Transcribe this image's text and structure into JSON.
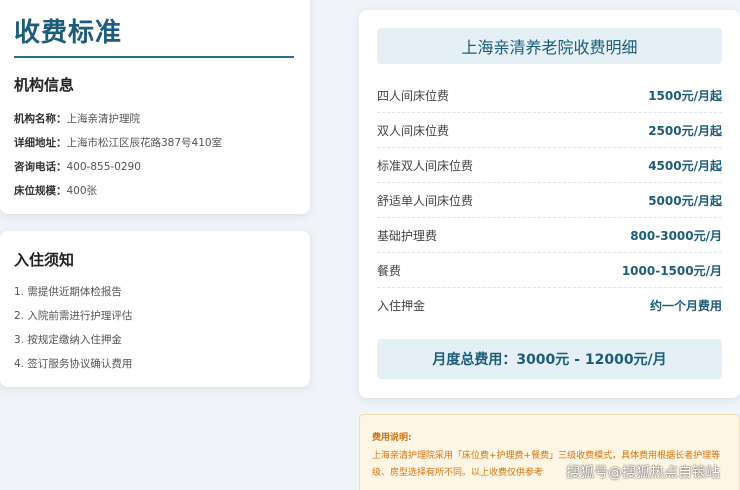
{
  "page": {
    "title": "收费标准"
  },
  "institution": {
    "heading": "机构信息",
    "fields": [
      {
        "label": "机构名称：",
        "value": "上海亲清护理院"
      },
      {
        "label": "详细地址：",
        "value": "上海市松江区辰花路387号410室"
      },
      {
        "label": "咨询电话：",
        "value": "400-855-0290"
      },
      {
        "label": "床位规模：",
        "value": "400张"
      }
    ]
  },
  "notice": {
    "heading": "入住须知",
    "items": [
      "1. 需提供近期体检报告",
      "2. 入院前需进行护理评估",
      "3. 按规定缴纳入住押金",
      "4. 签订服务协议确认费用"
    ]
  },
  "fees": {
    "heading": "上海亲清养老院收费明细",
    "rows": [
      {
        "name": "四人间床位费",
        "value": "1500元/月起"
      },
      {
        "name": "双人间床位费",
        "value": "2500元/月起"
      },
      {
        "name": "标准双人间床位费",
        "value": "4500元/月起"
      },
      {
        "name": "舒适单人间床位费",
        "value": "5000元/月起"
      },
      {
        "name": "基础护理费",
        "value": "800-3000元/月"
      },
      {
        "name": "餐费",
        "value": "1000-1500元/月"
      },
      {
        "name": "入住押金",
        "value": "约一个月费用"
      }
    ],
    "total": "月度总费用：3000元 - 12000元/月"
  },
  "note": {
    "title": "费用说明:",
    "text": "上海亲清护理院采用「床位费+护理费+餐费」三级收费模式，具体费用根据长者护理等级、房型选择有所不同。以上收费仅供参考"
  },
  "watermark": "搜狐号@搜狐热点自锒站",
  "colors": {
    "accent": "#1d5c7a",
    "header_bg": "#e4f0f6",
    "note_text": "#d9720d",
    "note_bg": "#fdf6e4"
  }
}
